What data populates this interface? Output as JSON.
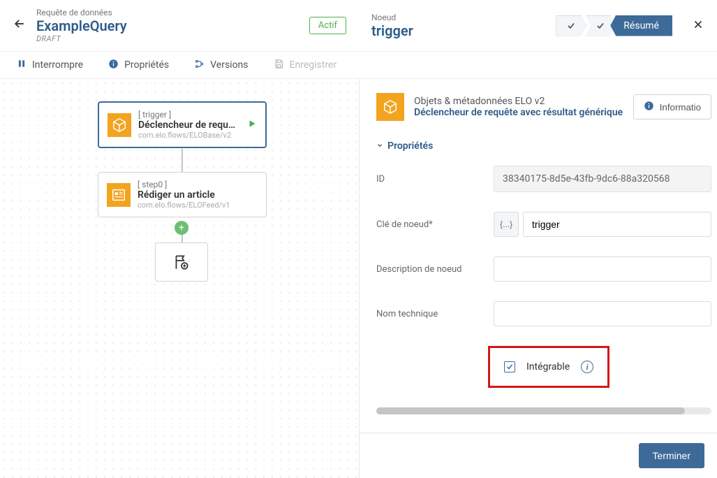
{
  "header_left": {
    "label": "Requête de données",
    "title": "ExampleQuery",
    "sub": "DRAFT",
    "status": "Actif"
  },
  "header_right": {
    "label": "Noeud",
    "title": "trigger",
    "tab_resume": "Résumé"
  },
  "toolbar": {
    "interrompre": "Interrompre",
    "proprietes": "Propriétés",
    "versions": "Versions",
    "enregistrer": "Enregistrer"
  },
  "canvas_nodes": {
    "trigger": {
      "label": "[ trigger ]",
      "title": "Déclencheur de requête a...",
      "path": "com.elo.flows/ELOBase/v2"
    },
    "step0": {
      "label": "[ step0 ]",
      "title": "Rédiger un article",
      "path": "com.elo.flows/ELOFeed/v1"
    }
  },
  "panel": {
    "h_line1": "Objets & métadonnées ELO   v2",
    "h_line2": "Déclencheur de requête avec résultat générique",
    "info_btn": "Informatio",
    "section": "Propriétés",
    "fields": {
      "id_label": "ID",
      "id_value": "38340175-8d5e-43fb-9dc6-88a320568",
      "nodekey_label": "Clé de noeud*",
      "nodekey_prefix": "{...}",
      "nodekey_value": "trigger",
      "desc_label": "Description de noeud",
      "desc_value": "",
      "tech_label": "Nom technique",
      "tech_value": "",
      "integrable_label": "Intégrable"
    },
    "footer_btn": "Terminer"
  }
}
